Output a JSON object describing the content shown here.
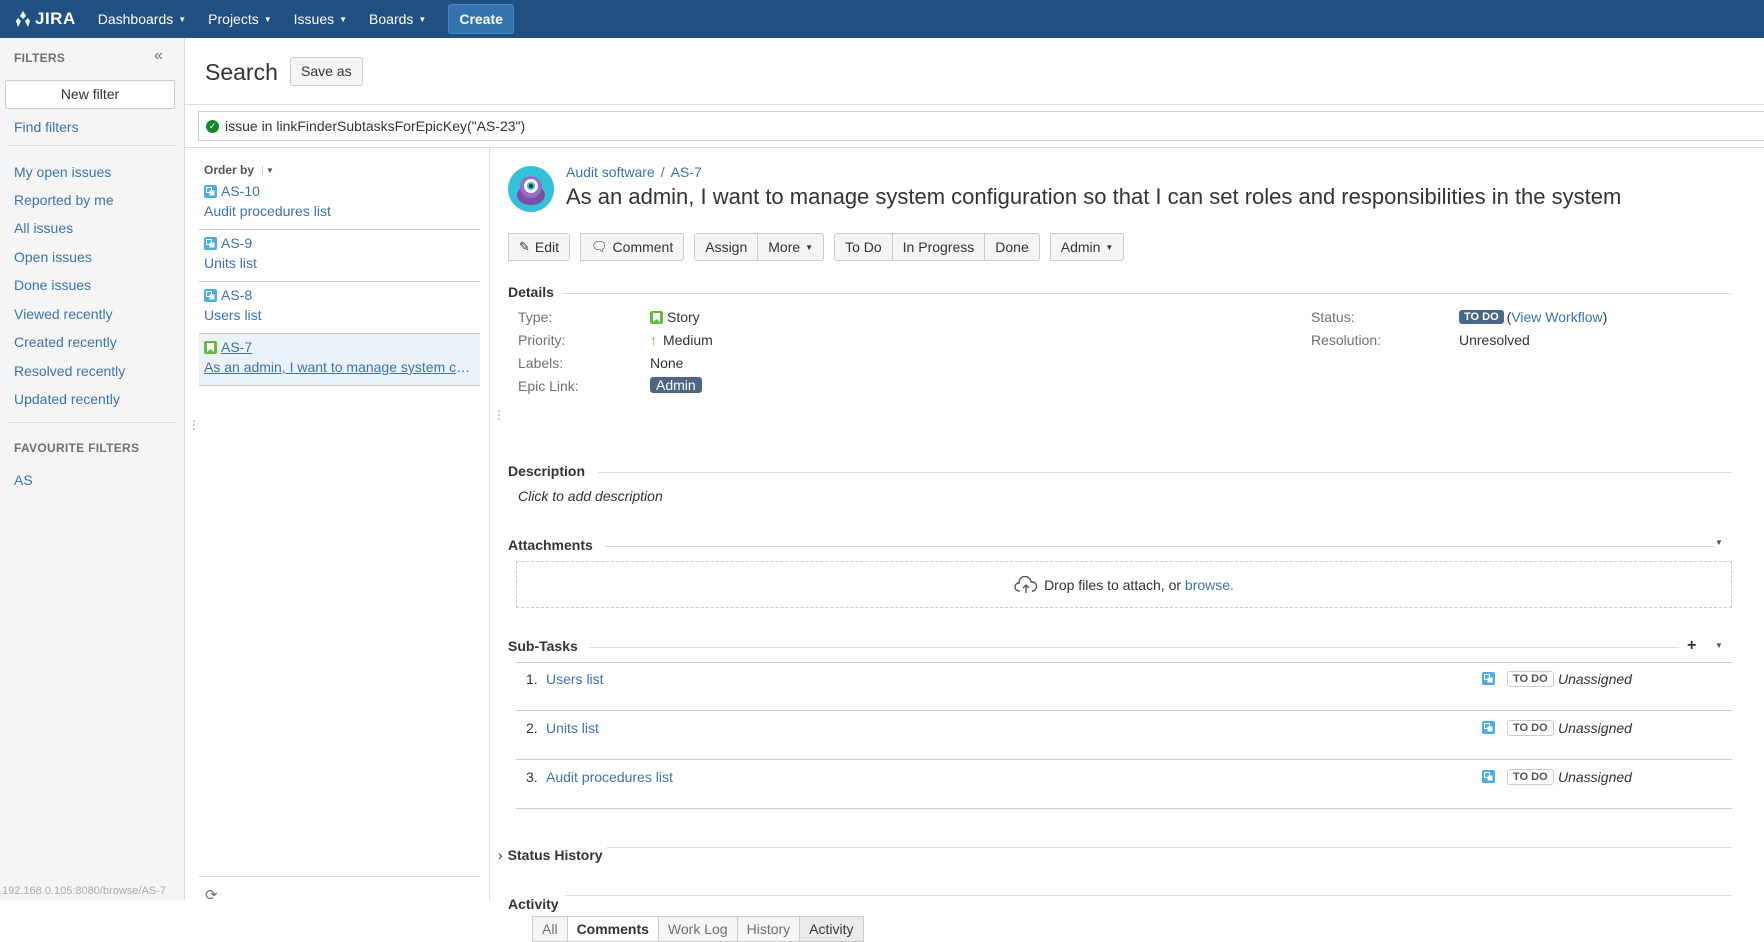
{
  "nav": {
    "logo": "JIRA",
    "items": [
      {
        "label": "Dashboards"
      },
      {
        "label": "Projects"
      },
      {
        "label": "Issues"
      },
      {
        "label": "Boards"
      }
    ],
    "create_label": "Create"
  },
  "sidebar": {
    "header": "FILTERS",
    "new_filter": "New filter",
    "find_filters": "Find filters",
    "items": [
      "My open issues",
      "Reported by me",
      "All issues",
      "Open issues",
      "Done issues",
      "Viewed recently",
      "Created recently",
      "Resolved recently",
      "Updated recently"
    ],
    "favourites_header": "FAVOURITE FILTERS",
    "favourites": [
      "AS"
    ]
  },
  "status_url": "192.168.0.105:8080/browse/AS-7",
  "search": {
    "title": "Search",
    "save_as": "Save as",
    "jql": "issue in linkFinderSubtasksForEpicKey(\"AS-23\")"
  },
  "list": {
    "order_by": "Order by",
    "issues": [
      {
        "key": "AS-10",
        "summary": "Audit procedures list",
        "type": "subtask"
      },
      {
        "key": "AS-9",
        "summary": "Units list",
        "type": "subtask"
      },
      {
        "key": "AS-8",
        "summary": "Users list",
        "type": "subtask"
      },
      {
        "key": "AS-7",
        "summary": "As an admin, I want to manage system configuration so that I can set roles and responsibilities in the system",
        "type": "story",
        "selected": true
      }
    ]
  },
  "issue": {
    "project": "Audit software",
    "key": "AS-7",
    "summary": "As an admin, I want to manage system configuration so that I can set roles and responsibilities in the system",
    "toolbar": {
      "edit": "Edit",
      "comment": "Comment",
      "assign": "Assign",
      "more": "More",
      "todo": "To Do",
      "in_progress": "In Progress",
      "done": "Done",
      "admin": "Admin"
    },
    "details": {
      "header": "Details",
      "type_label": "Type:",
      "type_value": "Story",
      "priority_label": "Priority:",
      "priority_value": "Medium",
      "labels_label": "Labels:",
      "labels_value": "None",
      "epic_label": "Epic Link:",
      "epic_value": "Admin",
      "status_label": "Status:",
      "status_value": "TO DO",
      "view_workflow": "View Workflow",
      "resolution_label": "Resolution:",
      "resolution_value": "Unresolved"
    },
    "description": {
      "header": "Description",
      "placeholder": "Click to add description"
    },
    "attachments": {
      "header": "Attachments",
      "drop_text": "Drop files to attach, or ",
      "browse": "browse."
    },
    "subtasks": {
      "header": "Sub-Tasks",
      "rows": [
        {
          "num": "1.",
          "name": "Users list",
          "status": "TO DO",
          "assignee": "Unassigned"
        },
        {
          "num": "2.",
          "name": "Units list",
          "status": "TO DO",
          "assignee": "Unassigned"
        },
        {
          "num": "3.",
          "name": "Audit procedures list",
          "status": "TO DO",
          "assignee": "Unassigned"
        }
      ]
    },
    "status_history": "Status History",
    "activity": {
      "header": "Activity",
      "tabs": [
        "All",
        "Comments",
        "Work Log",
        "History",
        "Activity"
      ]
    }
  },
  "colors": {
    "nav_bg": "#205081",
    "link": "#3b73af",
    "status_badge": "#4a6785"
  }
}
